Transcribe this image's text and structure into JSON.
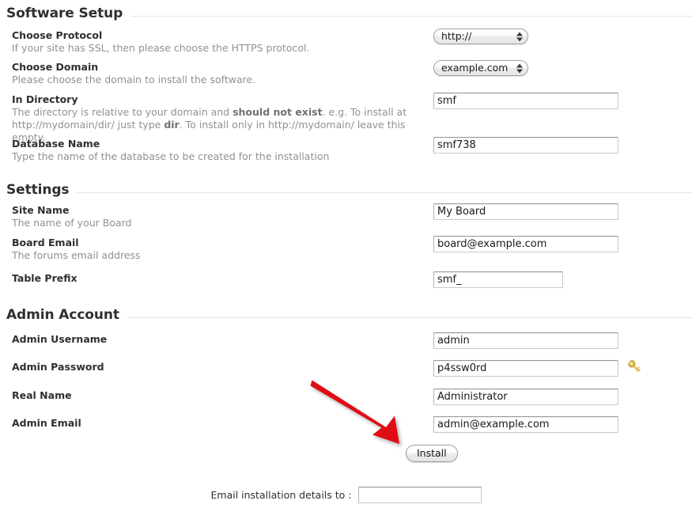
{
  "sections": [
    {
      "title": "Software Setup",
      "fields": [
        {
          "label": "Choose Protocol",
          "desc_parts": [
            {
              "text": "If your site has SSL, then please choose the HTTPS protocol.",
              "bold": false
            }
          ],
          "control": "select",
          "value": "http://"
        },
        {
          "label": "Choose Domain",
          "desc_parts": [
            {
              "text": "Please choose the domain to install the software.",
              "bold": false
            }
          ],
          "control": "select",
          "value": "example.com"
        },
        {
          "label": "In Directory",
          "desc_parts": [
            {
              "text": "The directory is relative to your domain and ",
              "bold": false
            },
            {
              "text": "should not exist",
              "bold": true
            },
            {
              "text": ". e.g. To install at http://mydomain/dir/ just type ",
              "bold": false
            },
            {
              "text": "dir",
              "bold": true
            },
            {
              "text": ". To install only in http://mydomain/ leave this empty.",
              "bold": false
            }
          ],
          "control": "text",
          "value": "smf"
        },
        {
          "label": "Database Name",
          "desc_parts": [
            {
              "text": "Type the name of the database to be created for the installation",
              "bold": false
            }
          ],
          "control": "text",
          "value": "smf738"
        }
      ]
    },
    {
      "title": "Settings",
      "fields": [
        {
          "label": "Site Name",
          "desc_parts": [
            {
              "text": "The name of your Board",
              "bold": false
            }
          ],
          "control": "text",
          "value": "My Board"
        },
        {
          "label": "Board Email",
          "desc_parts": [
            {
              "text": "The forums email address",
              "bold": false
            }
          ],
          "control": "text",
          "value": "board@example.com"
        },
        {
          "label": "Table Prefix",
          "desc_parts": [],
          "control": "text",
          "value": "smf_"
        }
      ]
    },
    {
      "title": "Admin Account",
      "fields": [
        {
          "label": "Admin Username",
          "desc_parts": [],
          "control": "text",
          "value": "admin"
        },
        {
          "label": "Admin Password",
          "desc_parts": [],
          "control": "text",
          "value": "p4ssw0rd",
          "trailing_icon": "key-icon"
        },
        {
          "label": "Real Name",
          "desc_parts": [],
          "control": "text",
          "value": "Administrator"
        },
        {
          "label": "Admin Email",
          "desc_parts": [],
          "control": "text",
          "value": "admin@example.com"
        }
      ]
    }
  ],
  "install_button": {
    "label": "Install"
  },
  "email_details": {
    "label": "Email installation details to :",
    "value": "",
    "placeholder": ""
  },
  "annotation": {
    "type": "arrow",
    "color": "#e00a18",
    "points_to": "install-button"
  },
  "colors": {
    "heading": "#2f2f2f",
    "description": "#8d9296",
    "rule": "#e2e6e6",
    "arrow_red": "#e00a18",
    "key_gold": "#e8c15a"
  }
}
